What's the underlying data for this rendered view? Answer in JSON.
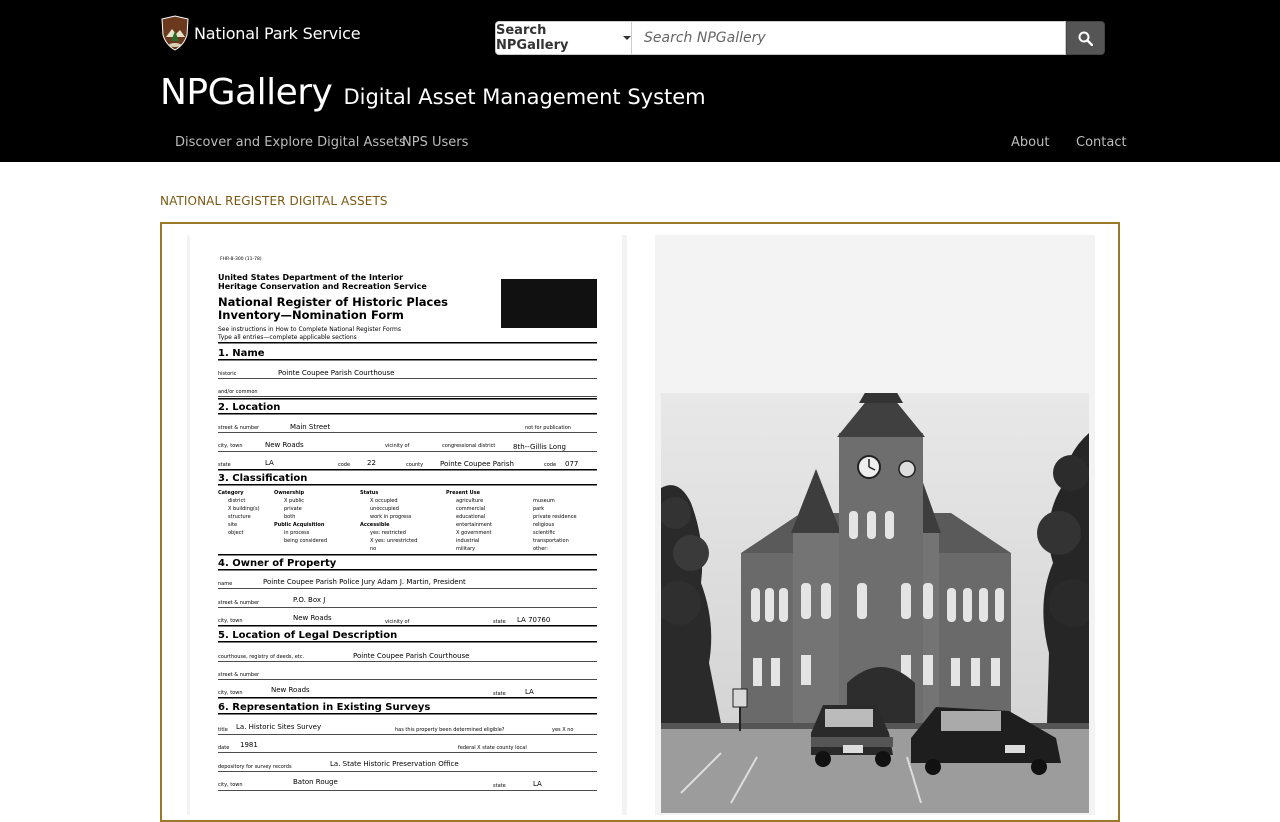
{
  "header": {
    "brand": "National Park Service",
    "search": {
      "dropdown_label": "Search NPGallery",
      "placeholder": "Search NPGallery"
    },
    "title": "NPGallery",
    "subtitle": "Digital Asset Management System",
    "nav_left": [
      "Discover and Explore Digital Assets",
      "NPS Users"
    ],
    "nav_right": [
      "About",
      "Contact"
    ]
  },
  "section_label": "NATIONAL REGISTER DIGITAL ASSETS",
  "document": {
    "form_number": "FHR-8-300 (11-78)",
    "agency_line1": "United States Department of the Interior",
    "agency_line2": "Heritage Conservation and Recreation Service",
    "form_title1": "National Register of Historic Places",
    "form_title2": "Inventory—Nomination Form",
    "instructions1": "See instructions in How to Complete National Register Forms",
    "instructions2": "Type all entries—complete applicable sections",
    "s1": "1.  Name",
    "historic_label": "historic",
    "historic_value": "Pointe Coupee Parish Courthouse",
    "common_label": "and/or common",
    "s2": "2.  Location",
    "street_label": "street & number",
    "street_value": "Main Street",
    "not_pub": "not for publication",
    "city_label": "city, town",
    "city_value": "New Roads",
    "vicinity_of": "vicinity of",
    "cong_label": "congressional district",
    "cong_value": "8th--Gillis Long",
    "state_label": "state",
    "state_value": "LA",
    "code_label": "code",
    "code_value": "22",
    "county_label": "county",
    "county_value": "Pointe Coupee Parish",
    "code2_value": "077",
    "s3": "3.  Classification",
    "cls_col1": [
      "Category",
      "district",
      "X  building(s)",
      "structure",
      "site",
      "object"
    ],
    "cls_col2": [
      "Ownership",
      "X  public",
      "private",
      "both",
      "Public Acquisition",
      "in process",
      "being considered"
    ],
    "cls_col3": [
      "Status",
      "X  occupied",
      "unoccupied",
      "work in progress",
      "Accessible",
      "yes: restricted",
      "X  yes: unrestricted",
      "no"
    ],
    "cls_col4": [
      "Present Use",
      "agriculture",
      "commercial",
      "educational",
      "entertainment",
      "X  government",
      "industrial",
      "military"
    ],
    "cls_col5": [
      "museum",
      "park",
      "private residence",
      "religious",
      "scientific",
      "transportation",
      "other:"
    ],
    "s4": "4.  Owner of Property",
    "name_label": "name",
    "owner_value": "Pointe Coupee Parish Police Jury        Adam J. Martin, President",
    "owner_street_value": "P.O. Box J",
    "owner_city_value": "New Roads",
    "owner_state_value": "LA   70760",
    "s5": "5.  Location of Legal Description",
    "courthouse_label": "courthouse, registry of deeds, etc.",
    "courthouse_value": "Pointe Coupee Parish Courthouse",
    "legal_city_value": "New Roads",
    "legal_state_value": "LA",
    "s6": "6.  Representation in Existing Surveys",
    "title_label": "title",
    "survey_value": "La. Historic Sites Survey",
    "eligible_label": "has this property been determined eligible?",
    "yes_no": "yes   X  no",
    "date_label": "date",
    "date_value": "1981",
    "levels": "federal   X  state      county      local",
    "depository_label": "depository for survey records",
    "depository_value": "La. State Historic Preservation Office",
    "dep_city_value": "Baton Rouge",
    "dep_state_value": "LA"
  },
  "colors": {
    "header_bg": "#000000",
    "accent": "#9a7a2a",
    "section_label": "#7a5a13"
  },
  "icons": {
    "brand": "nps-arrowhead-icon",
    "search": "search-icon",
    "dropdown": "caret-down-icon"
  }
}
